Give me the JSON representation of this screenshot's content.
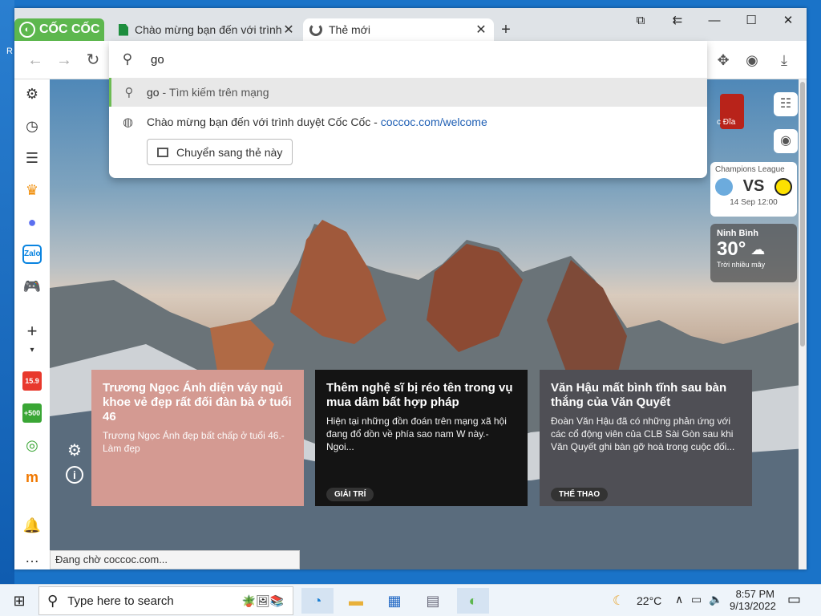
{
  "browser": {
    "brand": "CỐC CỐC",
    "tabs": [
      {
        "label": "Chào mừng bạn đến với trình",
        "icon": "doc-icon"
      },
      {
        "label": "Thẻ mới",
        "icon": "loading-icon"
      }
    ]
  },
  "omnibox": {
    "value": "go",
    "suggestions": [
      {
        "text": "go",
        "sep": " - ",
        "hint": "Tìm kiếm trên mạng",
        "icon": "search-icon"
      },
      {
        "text": "Chào mừng bạn đến với trình duyệt Cốc Cốc",
        "sep": " - ",
        "hint": "coccoc.com/welcome",
        "icon": "globe-icon"
      }
    ],
    "switch_tab_label": "Chuyển sang thẻ này"
  },
  "widgets": {
    "game_label": "c Đĩa",
    "match": {
      "league": "Champions League",
      "vs": "VS",
      "datetime": "14 Sep 12:00"
    },
    "weather": {
      "location": "Ninh Bình",
      "temp": "30°",
      "condition": "Trời nhiều mây"
    }
  },
  "news": [
    {
      "title": "Trương Ngọc Ánh diện váy ngủ khoe vẻ đẹp rất đối đàn bà ở tuổi 46",
      "desc": "Trương Ngọc Ánh đẹp bất chấp ở tuổi 46.-Làm đẹp",
      "tag": "",
      "color": "#d49a92"
    },
    {
      "title": "Thêm nghệ sĩ bị réo tên trong vụ mua dâm bất hợp pháp",
      "desc": "Hiện tại những đồn đoán trên mạng xã hội đang đổ dồn về phía sao nam W này.-Ngoi...",
      "tag": "GIẢI TRÍ",
      "color": "#141414"
    },
    {
      "title": "Văn Hậu mất bình tĩnh sau bàn thắng của Văn Quyết",
      "desc": "Đoàn Văn Hậu đã có những phản ứng với các cổ động viên của CLB Sài Gòn sau khi Văn Quyết ghi bàn gỡ hoà trong cuộc đối...",
      "tag": "THỂ THAO",
      "color": "#4f4f55"
    }
  ],
  "status_text": "Đang chờ coccoc.com...",
  "taskbar": {
    "search_placeholder": "Type here to search",
    "weather": "22°C",
    "time": "8:57 PM",
    "date": "9/13/2022"
  },
  "colors": {
    "brand": "#5db74e",
    "accent": "#6dbb54"
  }
}
